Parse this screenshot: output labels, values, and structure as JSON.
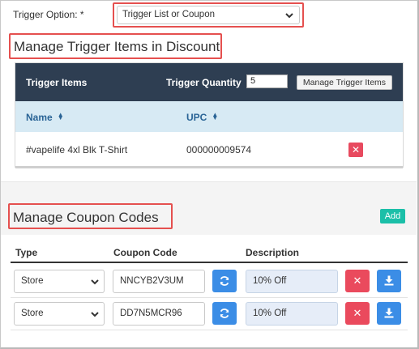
{
  "trigger": {
    "label": "Trigger Option: *",
    "selected": "Trigger List or Coupon"
  },
  "trigger_items_section": {
    "title": "Manage Trigger Items in Discount",
    "panel_title": "Trigger Items",
    "quantity_label": "Trigger Quantity",
    "quantity_value": "5",
    "manage_button": "Manage Trigger Items",
    "columns": {
      "name": "Name",
      "upc": "UPC"
    },
    "rows": [
      {
        "name": "#vapelife 4xl Blk T-Shirt",
        "upc": "000000009574"
      }
    ]
  },
  "coupon_section": {
    "title": "Manage Coupon Codes",
    "add_button": "Add",
    "columns": {
      "type": "Type",
      "code": "Coupon Code",
      "description": "Description"
    },
    "rows": [
      {
        "type": "Store",
        "code": "NNCYB2V3UM",
        "description": "10% Off"
      },
      {
        "type": "Store",
        "code": "DD7N5MCR96",
        "description": "10% Off"
      }
    ]
  },
  "colors": {
    "header_dark": "#2e3e52",
    "column_header": "#d7eaf4",
    "primary_blue": "#3b8de6",
    "danger_red": "#ea4a5d",
    "teal": "#1bbfa8",
    "highlight_red_box": "#e5504f"
  },
  "icons": {
    "select_chevron": "chevron-down-icon",
    "sort": "sort-icon",
    "delete": "close-icon",
    "regenerate": "refresh-icon",
    "download": "download-icon"
  }
}
